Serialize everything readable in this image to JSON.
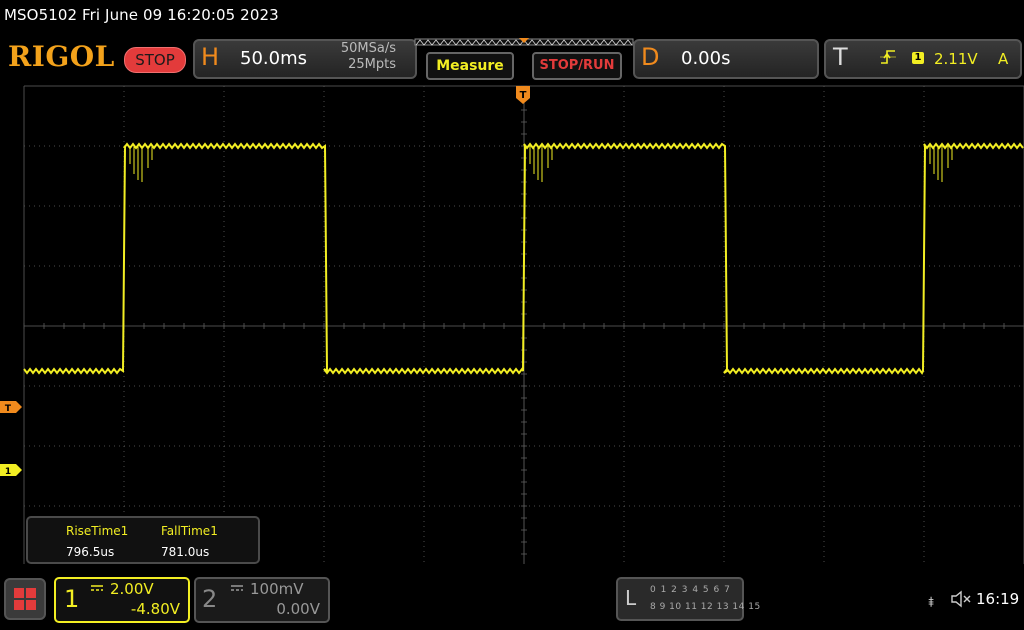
{
  "header": {
    "title": "MSO5102  Fri June 09 16:20:05 2023",
    "brand": "RIGOL",
    "run_state": "STOP"
  },
  "horizontal": {
    "letter": "H",
    "timebase": "50.0ms",
    "sample_rate": "50MSa/s",
    "memory_depth": "25Mpts"
  },
  "buttons": {
    "measure": "Measure",
    "stop_run": "STOP/RUN"
  },
  "delay": {
    "letter": "D",
    "value": "0.00s"
  },
  "trigger": {
    "letter": "T",
    "source": "1",
    "level": "2.11V",
    "mode": "A",
    "marker": "T"
  },
  "markers": {
    "ch1": "1"
  },
  "measurements": {
    "rise_label": "RiseTime1",
    "rise_value": "796.5us",
    "fall_label": "FallTime1",
    "fall_value": "781.0us"
  },
  "channels": {
    "ch1": {
      "number": "1",
      "scale": "2.00V",
      "offset": "-4.80V",
      "coupling_icon": "dc-coupling-icon"
    },
    "ch2": {
      "number": "2",
      "scale": "100mV",
      "offset": "0.00V",
      "coupling_icon": "dc-coupling-icon"
    }
  },
  "logic": {
    "letter": "L",
    "row1": "0 1 2 3  4 5 6 7",
    "row2": "8 9 10 11 12 13 14 15"
  },
  "status": {
    "time": "16:19"
  },
  "colors": {
    "ch1": "#f2ee23",
    "accent": "#f08a1d",
    "stop": "#e33b3b",
    "grid": "#555555"
  },
  "waveform": {
    "high_level_divs": 3,
    "low_level_divs": -0.75,
    "period_divs": 4,
    "rising_edges_divs": [
      1,
      5,
      9
    ],
    "falling_edges_divs": [
      3,
      7
    ]
  }
}
